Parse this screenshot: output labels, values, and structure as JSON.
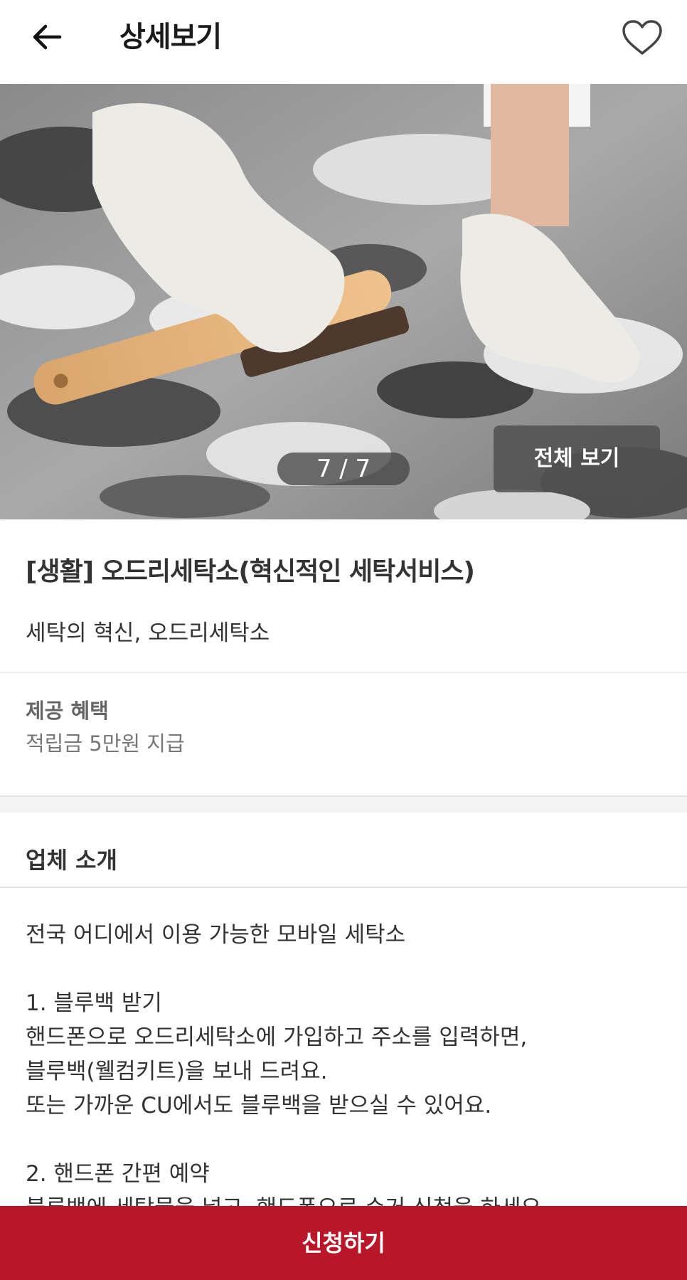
{
  "header": {
    "title": "상세보기",
    "back_icon": "arrow-left-icon",
    "favorite_icon": "heart-outline-icon"
  },
  "gallery": {
    "counter": "7 / 7",
    "view_all_label": "전체 보기"
  },
  "product": {
    "title": "[생활] 오드리세탁소(혁신적인 세탁서비스)",
    "subtitle": "세탁의 혁신, 오드리세탁소"
  },
  "benefit": {
    "label": "제공 혜택",
    "value": "적립금 5만원 지급"
  },
  "intro": {
    "title": "업체 소개",
    "lines": [
      "전국 어디에서 이용 가능한 모바일 세탁소",
      "",
      "1. 블루백 받기",
      "핸드폰으로 오드리세탁소에 가입하고 주소를 입력하면,",
      "블루백(웰컴키트)을 보내 드려요.",
      "또는 가까운 CU에서도 블루백을 받으실 수 있어요.",
      "",
      "2. 핸드폰 간편 예약",
      "블루백에 세탁물을 넣고, 핸드폰으로 수거 신청을 하세요."
    ]
  },
  "cta": {
    "label": "신청하기"
  },
  "colors": {
    "accent": "#b9162a",
    "text_primary": "#333333",
    "text_secondary": "#777777"
  }
}
